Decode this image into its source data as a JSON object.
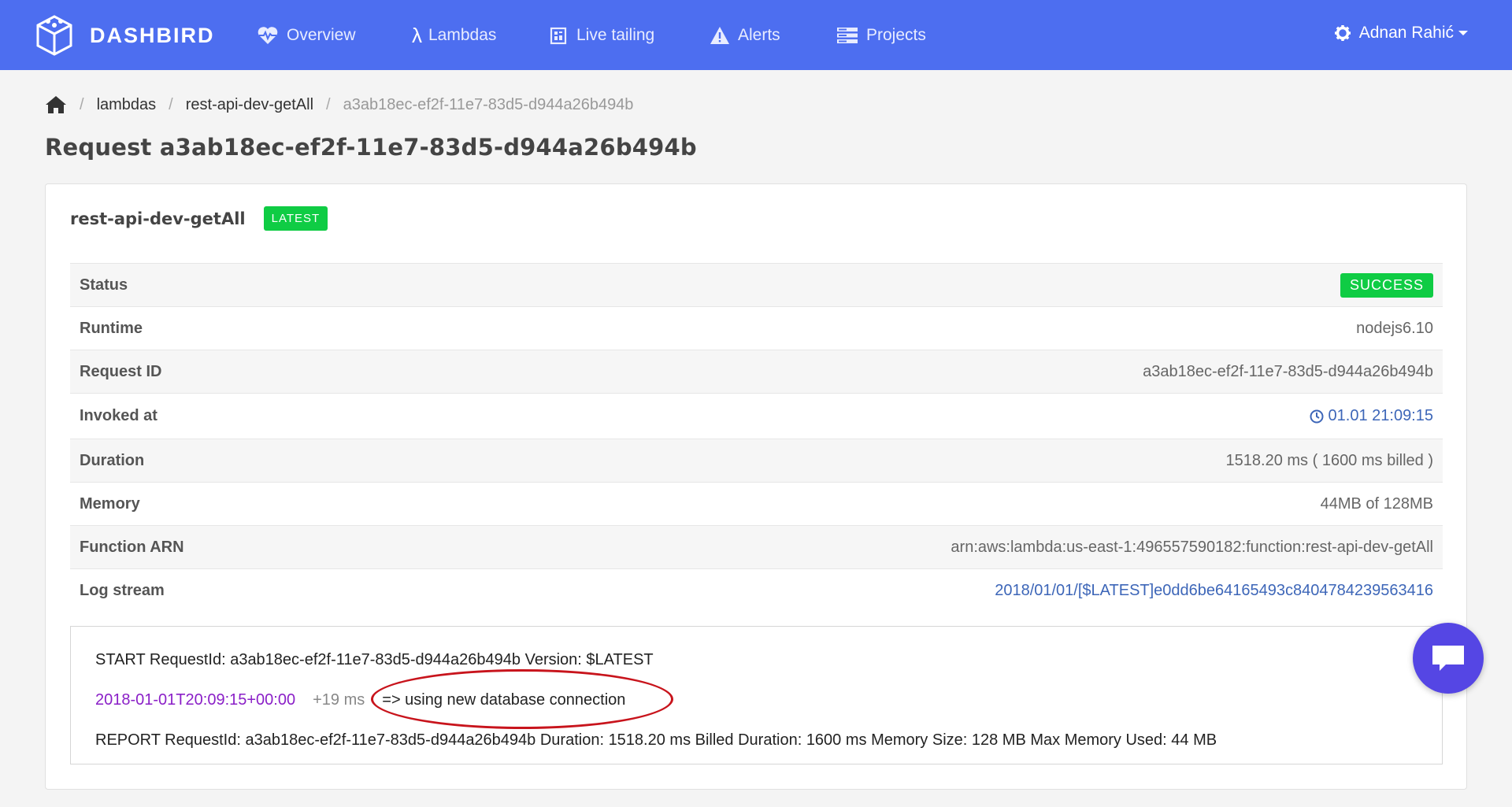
{
  "nav": {
    "brand": "DASHBIRD",
    "items": [
      {
        "label": "Overview",
        "icon": "heartbeat-icon"
      },
      {
        "label": "Lambdas",
        "icon": "lambda-icon"
      },
      {
        "label": "Live tailing",
        "icon": "live-tail-icon"
      },
      {
        "label": "Alerts",
        "icon": "warning-icon"
      },
      {
        "label": "Projects",
        "icon": "projects-icon"
      }
    ],
    "user": "Adnan Rahić"
  },
  "breadcrumb": {
    "items": [
      "lambdas",
      "rest-api-dev-getAll",
      "a3ab18ec-ef2f-11e7-83d5-d944a26b494b"
    ]
  },
  "page_title": "Request a3ab18ec-ef2f-11e7-83d5-d944a26b494b",
  "function": {
    "name": "rest-api-dev-getAll",
    "version_badge": "LATEST"
  },
  "details": [
    {
      "label": "Status",
      "value": "SUCCESS"
    },
    {
      "label": "Runtime",
      "value": "nodejs6.10"
    },
    {
      "label": "Request ID",
      "value": "a3ab18ec-ef2f-11e7-83d5-d944a26b494b"
    },
    {
      "label": "Invoked at",
      "value": "01.01 21:09:15"
    },
    {
      "label": "Duration",
      "value": "1518.20 ms ( 1600 ms billed )"
    },
    {
      "label": "Memory",
      "value": "44MB of 128MB"
    },
    {
      "label": "Function ARN",
      "value": "arn:aws:lambda:us-east-1:496557590182:function:rest-api-dev-getAll"
    },
    {
      "label": "Log stream",
      "value": "2018/01/01/[$LATEST]e0dd6be64165493c8404784239563416"
    }
  ],
  "colors": {
    "nav_bg": "#4d6ef0",
    "success": "#0fcc44",
    "link": "#3d66b8",
    "timestamp": "#8a1fc7",
    "annotation": "#c8141c",
    "chat": "#5546e4"
  },
  "log": {
    "start": "START RequestId: a3ab18ec-ef2f-11e7-83d5-d944a26b494b Version: $LATEST",
    "timestamp": "2018-01-01T20:09:15+00:00",
    "delta": "+19 ms",
    "message": "=> using new database connection",
    "report": "REPORT RequestId: a3ab18ec-ef2f-11e7-83d5-d944a26b494b Duration: 1518.20 ms Billed Duration: 1600 ms Memory Size: 128 MB Max Memory Used: 44 MB"
  }
}
